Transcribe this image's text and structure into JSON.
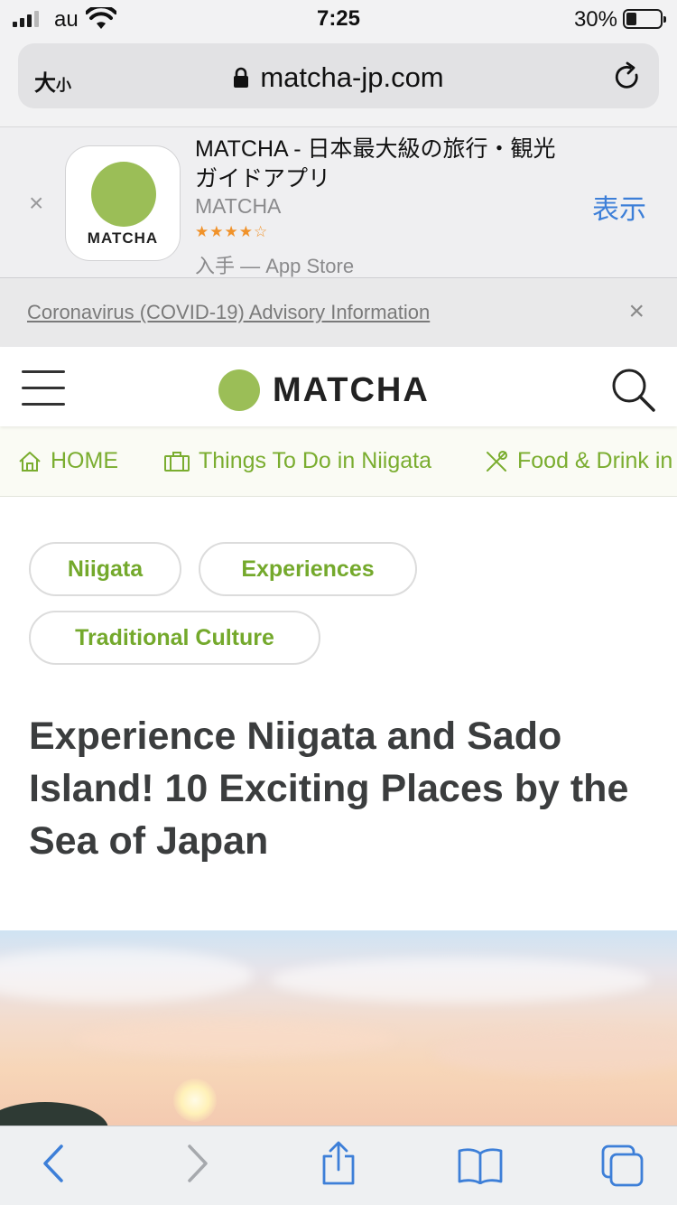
{
  "status_bar": {
    "carrier": "au",
    "time": "7:25",
    "battery_text": "30%",
    "battery_level": 0.3
  },
  "browser": {
    "text_size_label": "大",
    "text_size_small": "小",
    "url": "matcha-jp.com"
  },
  "app_banner": {
    "title": "MATCHA - 日本最大級の旅行・観光ガイドアプリ",
    "developer": "MATCHA",
    "icon_text": "MATCHA",
    "rating_stars": "★★★★☆",
    "rating": 4,
    "store_text": "入手 — App Store",
    "view_label": "表示",
    "close_glyph": "×"
  },
  "notice": {
    "text": "Coronavirus (COVID-19) Advisory Information",
    "close_glyph": "×"
  },
  "header": {
    "logo_text": "MATCHA"
  },
  "nav": {
    "items": [
      {
        "label": "HOME",
        "icon": "home-icon"
      },
      {
        "label": "Things To Do in Niigata",
        "icon": "suitcase-icon"
      },
      {
        "label": "Food & Drink in",
        "icon": "utensils-icon"
      }
    ]
  },
  "tags": [
    "Niigata",
    "Experiences",
    "Traditional Culture"
  ],
  "article": {
    "title": "Experience Niigata and Sado Island! 10 Exciting Places by the Sea of Japan"
  },
  "colors": {
    "brand_green": "#9bbe57",
    "tag_green": "#74a92c",
    "link_blue": "#3d7fd8",
    "star_orange": "#f0922a"
  }
}
